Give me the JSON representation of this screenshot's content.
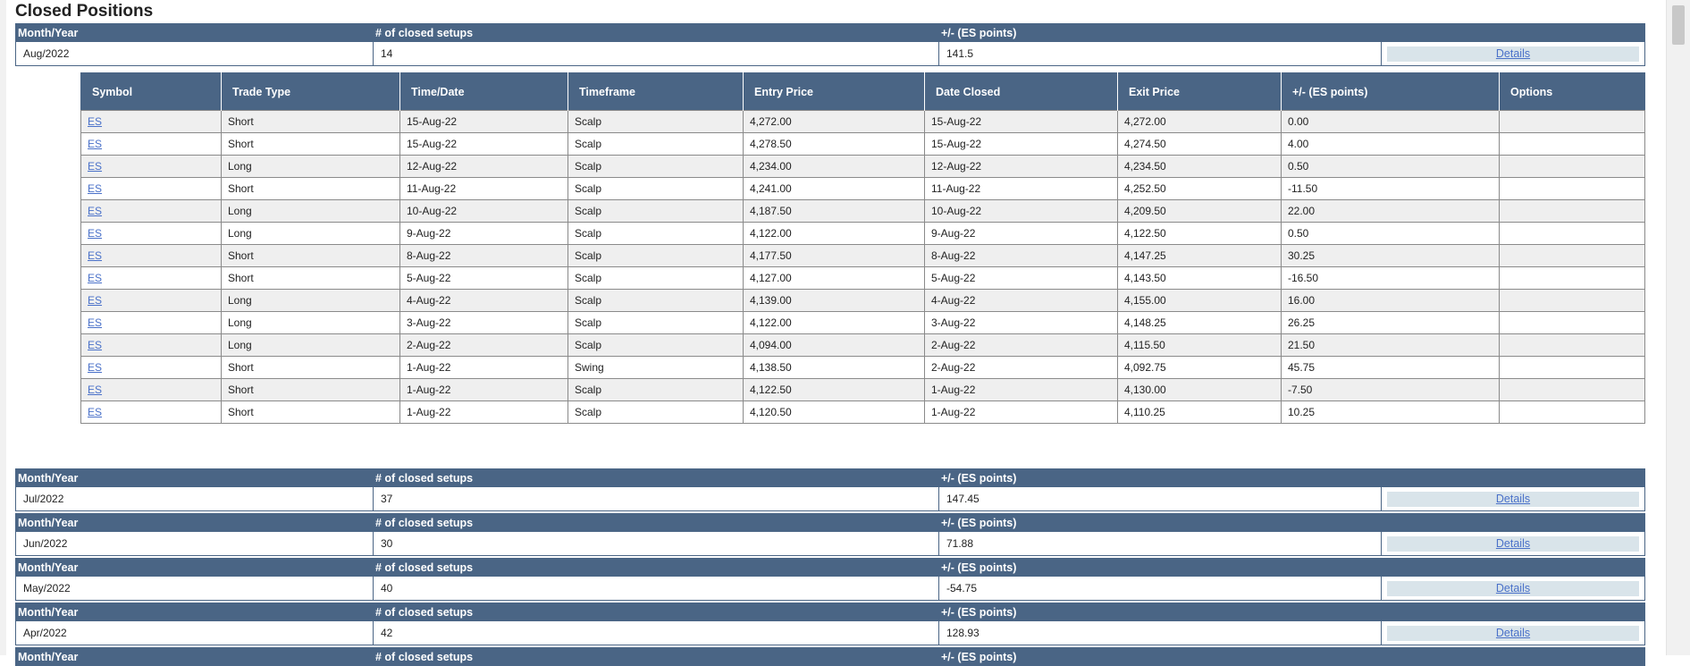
{
  "page": {
    "title": "Closed Positions"
  },
  "summary_headers": {
    "month": "Month/Year",
    "closed": "# of closed setups",
    "points": "+/- (ES points)"
  },
  "details_label": "Details",
  "expanded": {
    "month": "Aug/2022",
    "closed": "14",
    "points": "141.5",
    "columns": [
      "Symbol",
      "Trade Type",
      "Time/Date",
      "Timeframe",
      "Entry Price",
      "Date Closed",
      "Exit Price",
      "+/- (ES points)",
      "Options"
    ],
    "rows": [
      [
        "ES",
        "Short",
        "15-Aug-22",
        "Scalp",
        "4,272.00",
        "15-Aug-22",
        "4,272.00",
        "0.00",
        ""
      ],
      [
        "ES",
        "Short",
        "15-Aug-22",
        "Scalp",
        "4,278.50",
        "15-Aug-22",
        "4,274.50",
        "4.00",
        ""
      ],
      [
        "ES",
        "Long",
        "12-Aug-22",
        "Scalp",
        "4,234.00",
        "12-Aug-22",
        "4,234.50",
        "0.50",
        ""
      ],
      [
        "ES",
        "Short",
        "11-Aug-22",
        "Scalp",
        "4,241.00",
        "11-Aug-22",
        "4,252.50",
        "-11.50",
        ""
      ],
      [
        "ES",
        "Long",
        "10-Aug-22",
        "Scalp",
        "4,187.50",
        "10-Aug-22",
        "4,209.50",
        "22.00",
        ""
      ],
      [
        "ES",
        "Long",
        "9-Aug-22",
        "Scalp",
        "4,122.00",
        "9-Aug-22",
        "4,122.50",
        "0.50",
        ""
      ],
      [
        "ES",
        "Short",
        "8-Aug-22",
        "Scalp",
        "4,177.50",
        "8-Aug-22",
        "4,147.25",
        "30.25",
        ""
      ],
      [
        "ES",
        "Short",
        "5-Aug-22",
        "Scalp",
        "4,127.00",
        "5-Aug-22",
        "4,143.50",
        "-16.50",
        ""
      ],
      [
        "ES",
        "Long",
        "4-Aug-22",
        "Scalp",
        "4,139.00",
        "4-Aug-22",
        "4,155.00",
        "16.00",
        ""
      ],
      [
        "ES",
        "Long",
        "3-Aug-22",
        "Scalp",
        "4,122.00",
        "3-Aug-22",
        "4,148.25",
        "26.25",
        ""
      ],
      [
        "ES",
        "Long",
        "2-Aug-22",
        "Scalp",
        "4,094.00",
        "2-Aug-22",
        "4,115.50",
        "21.50",
        ""
      ],
      [
        "ES",
        "Short",
        "1-Aug-22",
        "Swing",
        "4,138.50",
        "2-Aug-22",
        "4,092.75",
        "45.75",
        ""
      ],
      [
        "ES",
        "Short",
        "1-Aug-22",
        "Scalp",
        "4,122.50",
        "1-Aug-22",
        "4,130.00",
        "-7.50",
        ""
      ],
      [
        "ES",
        "Short",
        "1-Aug-22",
        "Scalp",
        "4,120.50",
        "1-Aug-22",
        "4,110.25",
        "10.25",
        ""
      ]
    ]
  },
  "months": [
    {
      "month": "Jul/2022",
      "closed": "37",
      "points": "147.45"
    },
    {
      "month": "Jun/2022",
      "closed": "30",
      "points": "71.88"
    },
    {
      "month": "May/2022",
      "closed": "40",
      "points": "-54.75"
    },
    {
      "month": "Apr/2022",
      "closed": "42",
      "points": "128.93"
    }
  ],
  "partial_headers": {
    "month": "Month/Year",
    "closed": "# of closed setups",
    "points": "+/- (ES points)"
  }
}
